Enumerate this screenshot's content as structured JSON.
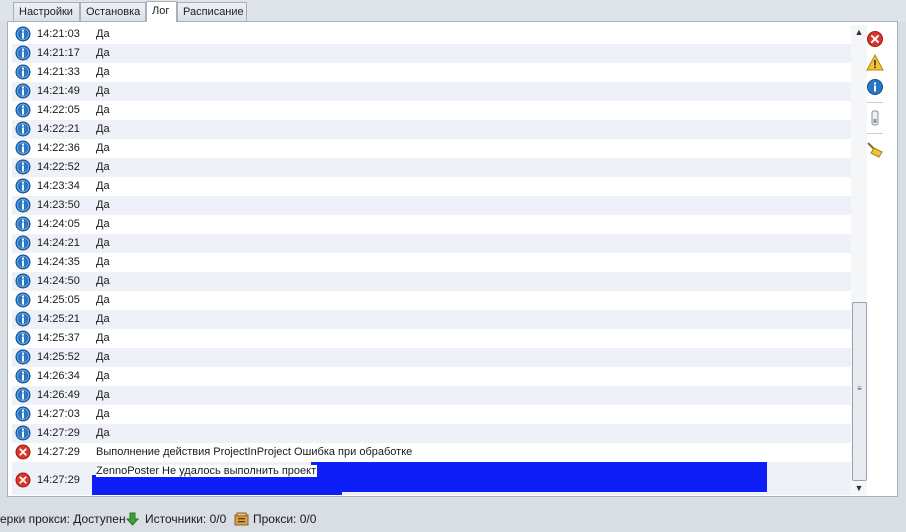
{
  "tabs": [
    {
      "label": "Настройки"
    },
    {
      "label": "Остановка"
    },
    {
      "label": "Лог"
    },
    {
      "label": "Расписание"
    }
  ],
  "log": {
    "rows": [
      {
        "level": "info",
        "time": "14:21:03",
        "message": "Да"
      },
      {
        "level": "info",
        "time": "14:21:17",
        "message": "Да"
      },
      {
        "level": "info",
        "time": "14:21:33",
        "message": "Да"
      },
      {
        "level": "info",
        "time": "14:21:49",
        "message": "Да"
      },
      {
        "level": "info",
        "time": "14:22:05",
        "message": "Да"
      },
      {
        "level": "info",
        "time": "14:22:21",
        "message": "Да"
      },
      {
        "level": "info",
        "time": "14:22:36",
        "message": "Да"
      },
      {
        "level": "info",
        "time": "14:22:52",
        "message": "Да"
      },
      {
        "level": "info",
        "time": "14:23:34",
        "message": "Да"
      },
      {
        "level": "info",
        "time": "14:23:50",
        "message": "Да"
      },
      {
        "level": "info",
        "time": "14:24:05",
        "message": "Да"
      },
      {
        "level": "info",
        "time": "14:24:21",
        "message": "Да"
      },
      {
        "level": "info",
        "time": "14:24:35",
        "message": "Да"
      },
      {
        "level": "info",
        "time": "14:24:50",
        "message": "Да"
      },
      {
        "level": "info",
        "time": "14:25:05",
        "message": "Да"
      },
      {
        "level": "info",
        "time": "14:25:21",
        "message": "Да"
      },
      {
        "level": "info",
        "time": "14:25:37",
        "message": "Да"
      },
      {
        "level": "info",
        "time": "14:25:52",
        "message": "Да"
      },
      {
        "level": "info",
        "time": "14:26:34",
        "message": "Да"
      },
      {
        "level": "info",
        "time": "14:26:49",
        "message": "Да"
      },
      {
        "level": "info",
        "time": "14:27:03",
        "message": "Да"
      },
      {
        "level": "info",
        "time": "14:27:29",
        "message": "Да"
      },
      {
        "level": "error",
        "time": "14:27:29",
        "message": "Выполнение действия ProjectInProject Ошибка при обработке"
      },
      {
        "level": "error",
        "time": "14:27:29",
        "message": "ZennoPoster Не удалось выполнить проект",
        "selected": true
      }
    ]
  },
  "sidebar": {
    "icons": [
      "error-filter-icon",
      "warning-filter-icon",
      "info-filter-icon",
      "scroll-lock-icon",
      "clear-log-icon"
    ]
  },
  "status": {
    "proxy_check": "ерки прокси: Доступен",
    "sources": "Источники: 0/0",
    "proxies": "Прокси: 0/0"
  },
  "colors": {
    "info": "#2a76c6",
    "error": "#d9352b",
    "selection": "#0d1ff6",
    "row_alt": "#eef2f8"
  }
}
